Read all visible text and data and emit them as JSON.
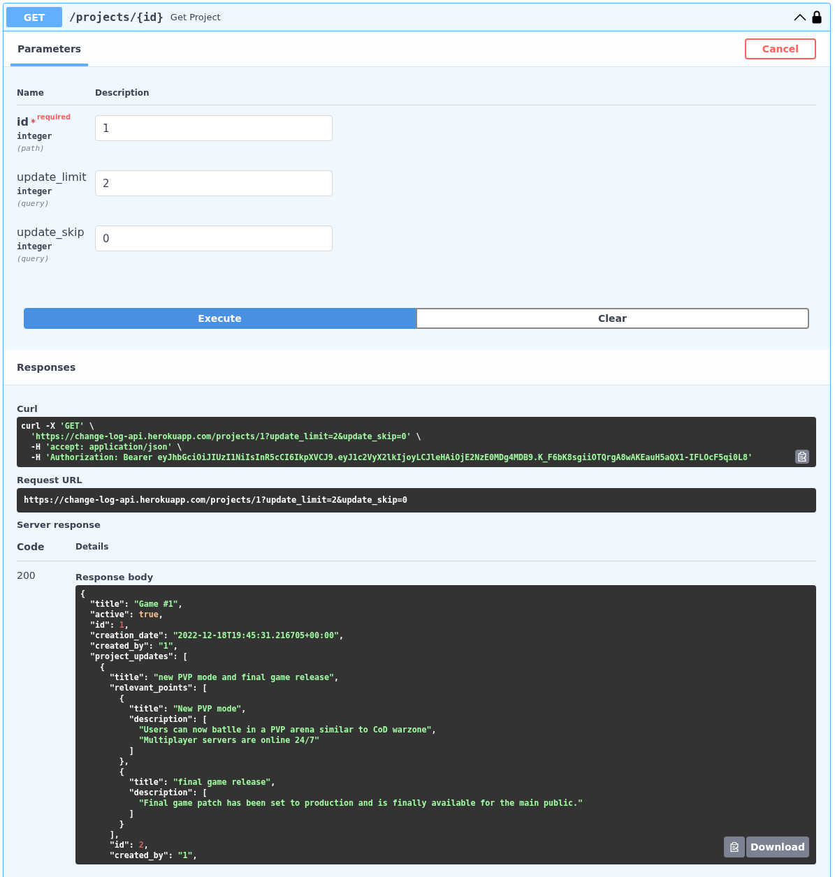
{
  "operation": {
    "method": "GET",
    "path": "/projects/{id}",
    "summary": "Get Project",
    "expanded": true,
    "locked": true
  },
  "tabs": [
    {
      "label": "Parameters",
      "selected": true
    }
  ],
  "cancel_button": "Cancel",
  "parameters": {
    "columns": [
      "Name",
      "Description"
    ],
    "rows": [
      {
        "name": "id",
        "required": true,
        "required_mark": "*",
        "required_label": "required",
        "type": "integer",
        "location": "(path)",
        "value": "1"
      },
      {
        "name": "update_limit",
        "required": false,
        "type": "integer",
        "location": "(query)",
        "value": "2"
      },
      {
        "name": "update_skip",
        "required": false,
        "type": "integer",
        "location": "(query)",
        "value": "0"
      }
    ]
  },
  "actions": [
    {
      "label": "Execute",
      "kind": "primary"
    },
    {
      "label": "Clear",
      "kind": "secondary"
    }
  ],
  "responses": {
    "title": "Responses",
    "curl_label": "Curl",
    "curl_lines": [
      [
        {
          "text": "curl -X ",
          "kind": "plain"
        },
        {
          "text": "'GET'",
          "kind": "string"
        },
        {
          "text": " \\",
          "kind": "plain"
        }
      ],
      [
        {
          "text": "  'https://change-log-api.herokuapp.com/projects/1?update_limit=2&update_skip=0'",
          "kind": "string"
        },
        {
          "text": " \\",
          "kind": "plain"
        }
      ],
      [
        {
          "text": "  -H ",
          "kind": "plain"
        },
        {
          "text": "'accept: application/json'",
          "kind": "string"
        },
        {
          "text": " \\",
          "kind": "plain"
        }
      ],
      [
        {
          "text": "  -H ",
          "kind": "plain"
        },
        {
          "text": "'Authorization: Bearer eyJhbGciOiJIUzI1NiIsInR5cCI6IkpXVCJ9.eyJ1c2VyX2lkIjoyLCJleHAiOjE2NzE0MDg4MDB9.K_F6bK8sgiiOTQrgA8wAKEauH5aQX1-IFLOcF5qi0L8'",
          "kind": "string"
        }
      ]
    ],
    "request_url_label": "Request URL",
    "request_url": "https://change-log-api.herokuapp.com/projects/1?update_limit=2&update_skip=0",
    "server_response_label": "Server response",
    "columns": [
      "Code",
      "Details"
    ],
    "rows": [
      {
        "code": "200",
        "body_label": "Response body",
        "download": "Download",
        "body_lines": [
          [
            {
              "text": "{",
              "kind": "plain"
            }
          ],
          [
            {
              "text": "  \"title\": ",
              "kind": "plain"
            },
            {
              "text": "\"Game #1\"",
              "kind": "string"
            },
            {
              "text": ",",
              "kind": "plain"
            }
          ],
          [
            {
              "text": "  \"active\": ",
              "kind": "plain"
            },
            {
              "text": "true",
              "kind": "boolean"
            },
            {
              "text": ",",
              "kind": "plain"
            }
          ],
          [
            {
              "text": "  \"id\": ",
              "kind": "plain"
            },
            {
              "text": "1",
              "kind": "number"
            },
            {
              "text": ",",
              "kind": "plain"
            }
          ],
          [
            {
              "text": "  \"creation_date\": ",
              "kind": "plain"
            },
            {
              "text": "\"2022-12-18T19:45:31.216705+00:00\"",
              "kind": "string"
            },
            {
              "text": ",",
              "kind": "plain"
            }
          ],
          [
            {
              "text": "  \"created_by\": ",
              "kind": "plain"
            },
            {
              "text": "\"1\"",
              "kind": "string"
            },
            {
              "text": ",",
              "kind": "plain"
            }
          ],
          [
            {
              "text": "  \"project_updates\": [",
              "kind": "plain"
            }
          ],
          [
            {
              "text": "    {",
              "kind": "plain"
            }
          ],
          [
            {
              "text": "      \"title\": ",
              "kind": "plain"
            },
            {
              "text": "\"new PVP mode and final game release\"",
              "kind": "string"
            },
            {
              "text": ",",
              "kind": "plain"
            }
          ],
          [
            {
              "text": "      \"relevant_points\": [",
              "kind": "plain"
            }
          ],
          [
            {
              "text": "        {",
              "kind": "plain"
            }
          ],
          [
            {
              "text": "          \"title\": ",
              "kind": "plain"
            },
            {
              "text": "\"New PVP mode\"",
              "kind": "string"
            },
            {
              "text": ",",
              "kind": "plain"
            }
          ],
          [
            {
              "text": "          \"description\": [",
              "kind": "plain"
            }
          ],
          [
            {
              "text": "            \"Users can now batlle in a PVP arena similar to CoD warzone\"",
              "kind": "string"
            },
            {
              "text": ",",
              "kind": "plain"
            }
          ],
          [
            {
              "text": "            \"Multiplayer servers are online 24/7\"",
              "kind": "string"
            }
          ],
          [
            {
              "text": "          ]",
              "kind": "plain"
            }
          ],
          [
            {
              "text": "        },",
              "kind": "plain"
            }
          ],
          [
            {
              "text": "        {",
              "kind": "plain"
            }
          ],
          [
            {
              "text": "          \"title\": ",
              "kind": "plain"
            },
            {
              "text": "\"final game release\"",
              "kind": "string"
            },
            {
              "text": ",",
              "kind": "plain"
            }
          ],
          [
            {
              "text": "          \"description\": [",
              "kind": "plain"
            }
          ],
          [
            {
              "text": "            \"Final game patch has been set to production and is finally available for the main public.\"",
              "kind": "string"
            }
          ],
          [
            {
              "text": "          ]",
              "kind": "plain"
            }
          ],
          [
            {
              "text": "        }",
              "kind": "plain"
            }
          ],
          [
            {
              "text": "      ],",
              "kind": "plain"
            }
          ],
          [
            {
              "text": "      \"id\": ",
              "kind": "plain"
            },
            {
              "text": "2",
              "kind": "number"
            },
            {
              "text": ",",
              "kind": "plain"
            }
          ],
          [
            {
              "text": "      \"created_by\": ",
              "kind": "plain"
            },
            {
              "text": "\"1\"",
              "kind": "string"
            },
            {
              "text": ",",
              "kind": "plain"
            }
          ]
        ]
      }
    ]
  }
}
